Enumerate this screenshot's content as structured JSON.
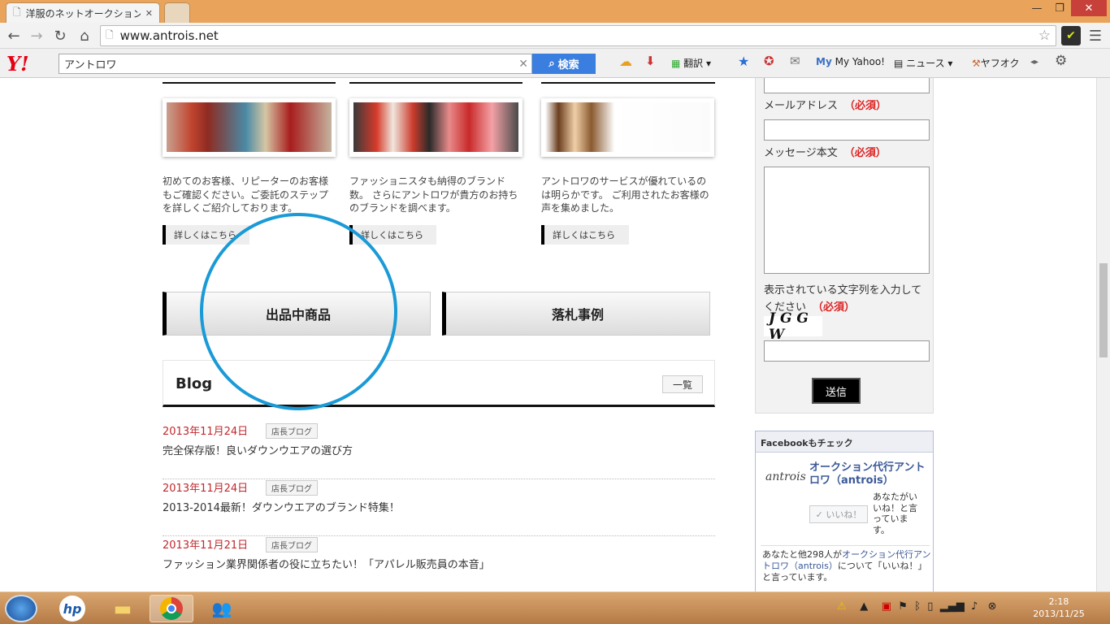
{
  "browser": {
    "tab_title": "洋服のネットオークション代行",
    "url": "www.antrois.net",
    "window_controls": {
      "minimize": "—",
      "maximize": "❐",
      "close": "✕"
    }
  },
  "yahoo_toolbar": {
    "logo": "Y!",
    "search_value": "アントロワ",
    "search_button": "検索",
    "translate": "翻訳",
    "my_yahoo": "My Yahoo!",
    "news": "ニュース",
    "auction": "ヤフオク"
  },
  "features": [
    {
      "desc": "初めてのお客様、リピーターのお客様もご確認ください。ご委託のステップを詳しくご紹介しております。",
      "button": "詳しくはこちら"
    },
    {
      "desc": "ファッショニスタも納得のブランド数。 さらにアントロワが貴方のお持ちのブランドを調べます。",
      "button": "詳しくはこちら"
    },
    {
      "desc": "アントロワのサービスが優れているのは明らかです。 ご利用されたお客様の声を集めました。",
      "button": "詳しくはこちら"
    }
  ],
  "big_buttons": {
    "listed": "出品中商品",
    "results": "落札事例"
  },
  "blog": {
    "title": "Blog",
    "list_button": "一覧",
    "posts": [
      {
        "date": "2013年11月24日",
        "tag": "店長ブログ",
        "title": "完全保存版！良いダウンウエアの選び方"
      },
      {
        "date": "2013年11月24日",
        "tag": "店長ブログ",
        "title": "2013-2014最新！ダウンウエアのブランド特集！"
      },
      {
        "date": "2013年11月21日",
        "tag": "店長ブログ",
        "title": "ファッション業界関係者の役に立ちたい！「アパレル販売員の本音」"
      }
    ]
  },
  "contact_form": {
    "email_label": "メールアドレス",
    "message_label": "メッセージ本文",
    "captcha_label": "表示されている文字列を入力してください",
    "required": "（必須）",
    "captcha_text": "J G G W",
    "submit": "送信"
  },
  "facebook": {
    "header": "Facebookもチェック",
    "logo": "antrois",
    "page_name": "オークション代行アントロワ（antrois）",
    "like_button": "✓ いいね！",
    "like_prompt": "あなたがいいね！と言っています。",
    "footer_pre": "あなたと他298人が",
    "footer_link": "オークション代行アントロワ（antrois）",
    "footer_post": "について「いいね！」と言っています。"
  },
  "taskbar": {
    "hp": "hp",
    "time": "2:18",
    "date": "2013/11/25"
  },
  "colors": {
    "annotation_circle": "#1a9ad6",
    "required": "#dd2222",
    "date": "#c0282d"
  }
}
